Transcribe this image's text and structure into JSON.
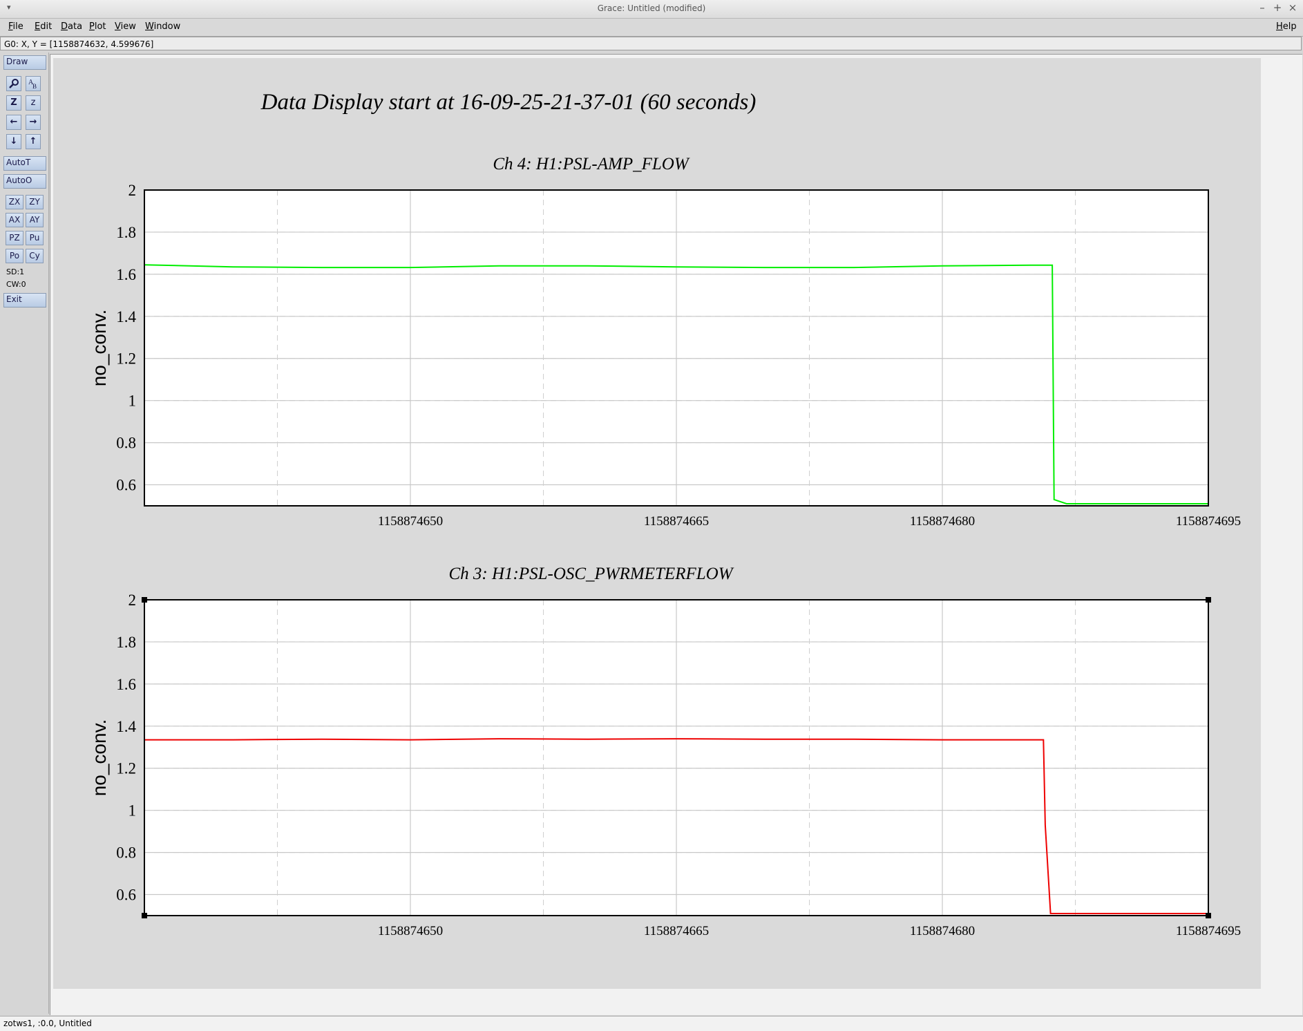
{
  "window": {
    "title": "Grace: Untitled (modified)",
    "menu_arrow": "▾",
    "min": "–",
    "max": "+",
    "close": "×"
  },
  "menubar": {
    "file": "File",
    "edit": "Edit",
    "data": "Data",
    "plot": "Plot",
    "view": "View",
    "window": "Window",
    "help": "Help"
  },
  "locator": "G0: X, Y = [1158874632, 4.599676]",
  "toolbox": {
    "draw": "Draw",
    "zoom_icon": "magnifier-icon",
    "text_icon": "text-tool-icon",
    "zoom_z": "Z",
    "zoom_small_z": "z",
    "left": "←",
    "right": "→",
    "down": "↓",
    "up": "↑",
    "autot": "AutoT",
    "autoo": "AutoO",
    "zx": "ZX",
    "zy": "ZY",
    "ax": "AX",
    "ay": "AY",
    "pz": "PZ",
    "pu": "Pu",
    "po": "Po",
    "cy": "Cy",
    "sd": "SD:1",
    "cw": "CW:0",
    "exit": "Exit"
  },
  "plot": {
    "main_title": "Data Display start at 16-09-25-21-37-01 (60 seconds)"
  },
  "chart_data": [
    {
      "type": "line",
      "title": "Ch 4: H1:PSL-AMP_FLOW",
      "ylabel": "no_conv.",
      "xlabel": "",
      "xlim": [
        1158874635,
        1158874695
      ],
      "ylim": [
        0.5,
        2.0
      ],
      "x_ticks": [
        1158874650,
        1158874665,
        1158874680,
        1158874695
      ],
      "y_ticks": [
        0.6,
        0.8,
        1,
        1.2,
        1.4,
        1.6,
        1.8,
        2
      ],
      "grid": true,
      "color": "#00ee00",
      "series": [
        {
          "x": [
            1158874635,
            1158874640,
            1158874645,
            1158874650,
            1158874655,
            1158874660,
            1158874665,
            1158874670,
            1158874675,
            1158874680,
            1158874685,
            1158874686.2,
            1158874686.3,
            1158874687,
            1158874690,
            1158874695
          ],
          "y": [
            1.645,
            1.635,
            1.632,
            1.632,
            1.64,
            1.64,
            1.635,
            1.632,
            1.632,
            1.64,
            1.643,
            1.643,
            0.53,
            0.51,
            0.51,
            0.51
          ]
        }
      ]
    },
    {
      "type": "line",
      "title": "Ch 3: H1:PSL-OSC_PWRMETERFLOW",
      "ylabel": "no_conv.",
      "xlabel": "",
      "xlim": [
        1158874635,
        1158874695
      ],
      "ylim": [
        0.5,
        2.0
      ],
      "x_ticks": [
        1158874650,
        1158874665,
        1158874680,
        1158874695
      ],
      "y_ticks": [
        0.6,
        0.8,
        1,
        1.2,
        1.4,
        1.6,
        1.8,
        2
      ],
      "grid": true,
      "color": "#ee0000",
      "series": [
        {
          "x": [
            1158874635,
            1158874640,
            1158874645,
            1158874650,
            1158874655,
            1158874660,
            1158874665,
            1158874670,
            1158874675,
            1158874680,
            1158874685,
            1158874685.7,
            1158874685.8,
            1158874686.1,
            1158874690,
            1158874695
          ],
          "y": [
            1.335,
            1.335,
            1.338,
            1.335,
            1.34,
            1.338,
            1.34,
            1.338,
            1.338,
            1.335,
            1.335,
            1.335,
            0.93,
            0.51,
            0.51,
            0.51
          ]
        }
      ]
    }
  ],
  "status": "zotws1, :0.0, Untitled"
}
